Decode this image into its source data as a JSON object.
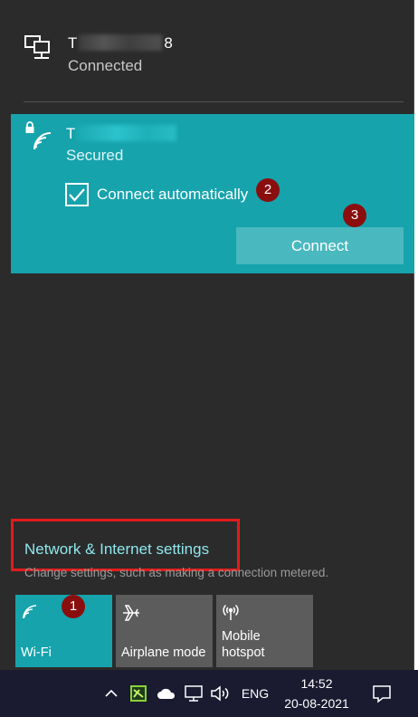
{
  "ethernet": {
    "name_start": "T",
    "name_end": "8",
    "status": "Connected",
    "icon": "ethernet-icon"
  },
  "wifi_network": {
    "name_start": "T",
    "status": "Secured",
    "auto_connect_label": "Connect automatically",
    "auto_connect_checked": true,
    "connect_label": "Connect",
    "icon": "wifi-secured-icon"
  },
  "settings": {
    "link": "Network & Internet settings",
    "description": "Change settings, such as making a connection metered."
  },
  "annotations": {
    "step_1": "1",
    "step_2": "2",
    "step_3": "3"
  },
  "quick_actions": [
    {
      "label": "Wi-Fi",
      "icon": "wifi-icon",
      "active": true
    },
    {
      "label": "Airplane mode",
      "icon": "airplane-icon",
      "active": false
    },
    {
      "label": "Mobile\nhotspot",
      "icon": "hotspot-icon",
      "active": false
    }
  ],
  "taskbar": {
    "language": "ENG",
    "time": "14:52",
    "date": "20-08-2021"
  },
  "colors": {
    "accent": "#16a3ac",
    "annotation_badge": "#8b0e0e",
    "highlight_box": "#e21b1b",
    "link": "#8ee7ed"
  }
}
